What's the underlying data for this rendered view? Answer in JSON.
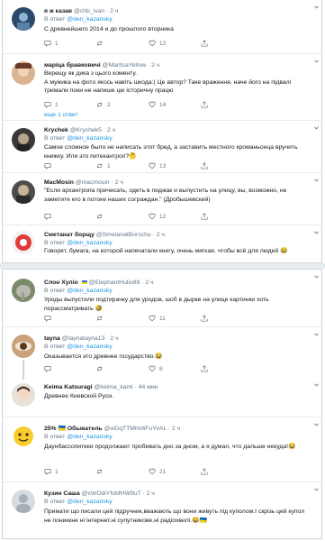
{
  "tweets_top": [
    {
      "name": "я ж казав",
      "handle": "@chb_ivan",
      "time": "· 2 ч",
      "reply_prefix": "В ответ",
      "reply_user": "@den_kazansky",
      "text": "С древнейшего 2014 и до прошлого вторника",
      "replies": "1",
      "retweets": "",
      "likes": "12"
    },
    {
      "name": "маріца бравковичі",
      "handle": "@MaritsaYellow",
      "time": "· 2 ч",
      "reply_prefix": "В ответ",
      "reply_user": "@den_kazansky",
      "text": "Верещу як дика з цього коменту.\nА мужика на фото якось навіть шкода:( Це автор? Таке враження, наче його на підвалі тримали поки не напише цю історичну працю",
      "replies": "1",
      "retweets": "2",
      "likes": "14",
      "more": "еще 1 ответ"
    },
    {
      "name": "Krychek",
      "handle": "@Krychek5",
      "time": "· 2 ч",
      "reply_prefix": "В ответ",
      "reply_user": "@den_kazansky",
      "text": "Самое сложное было не написать этот бред, а заставить местного кроманьонца вручить книжку. Или это питекантроп?🤔",
      "replies": "",
      "retweets": "1",
      "likes": "13"
    },
    {
      "name": "MacMosin",
      "handle": "@macmosin",
      "time": "· 2 ч",
      "reply_prefix": "В ответ",
      "reply_user": "@den_kazansky",
      "text": "\"Если архантропа причесать, одеть в пиджак и выпустить на улицу, вы, возможно, не заметите его в потоке наших сограждан.\" (Дробышевский)",
      "replies": "",
      "retweets": "",
      "likes": "12"
    },
    {
      "name": "Сметанат борщу",
      "handle": "@SmetanatBorschu",
      "time": "· 2 ч",
      "reply_prefix": "В ответ",
      "reply_user": "@den_kazansky",
      "text": "Говорят, бумага, на которой напечатали книгу, очень мягкая, чтобы всё для людей 😂"
    }
  ],
  "tweets_bottom": [
    {
      "name": "Слон Хуліо",
      "handle": "@ElephantHulio88",
      "time": "· 2 ч",
      "reply_prefix": "В ответ",
      "reply_user": "@den_kazansky",
      "text": "Уроды выпустили подтирачку для уродов, шоб в дырке на улице картинки хоть порассматривать 🤣",
      "replies": "",
      "retweets": "",
      "likes": "11"
    },
    {
      "name": "tayna",
      "handle": "@taynataynа13",
      "time": "· 2 ч",
      "reply_prefix": "В ответ",
      "reply_user": "@den_kazansky",
      "text": "Оказывается это древнее государство.😂",
      "replies": "",
      "retweets": "",
      "likes": "8"
    },
    {
      "name": "Keima Katsuragi",
      "handle": "@keima_kami",
      "time": "· 44 мин",
      "text": "Древнее Киевской Руси."
    },
    {
      "name": "25% 🇺🇦 Обыватель",
      "handle": "@wDqTTMhn6FuYvAL",
      "time": "· 2 ч",
      "reply_prefix": "В ответ",
      "reply_user": "@den_kazansky",
      "text": "Даунбассопитеки продолжают пробивать дно за дном, а я думал, что дальше некуда!😂",
      "replies": "1",
      "retweets": "",
      "likes": "21"
    },
    {
      "name": "Кузин Саша",
      "handle": "@xWOdiYfobfHW9uT",
      "time": "· 2 ч",
      "reply_prefix": "В ответ",
      "reply_user": "@den_kazansky",
      "text": "Примати що писали цей підручник,вважають що вони живуть під куполом.І скрізь цей купол не пониккне ні інтернет,ні супутникове,ні радіохвилі.😂🇺🇦"
    }
  ],
  "colors": {
    "link": "#1b95e0",
    "muted": "#657786",
    "border": "#e6ecf0"
  },
  "icons": [
    "reply-icon",
    "retweet-icon",
    "like-icon",
    "share-icon",
    "caret-down-icon"
  ]
}
